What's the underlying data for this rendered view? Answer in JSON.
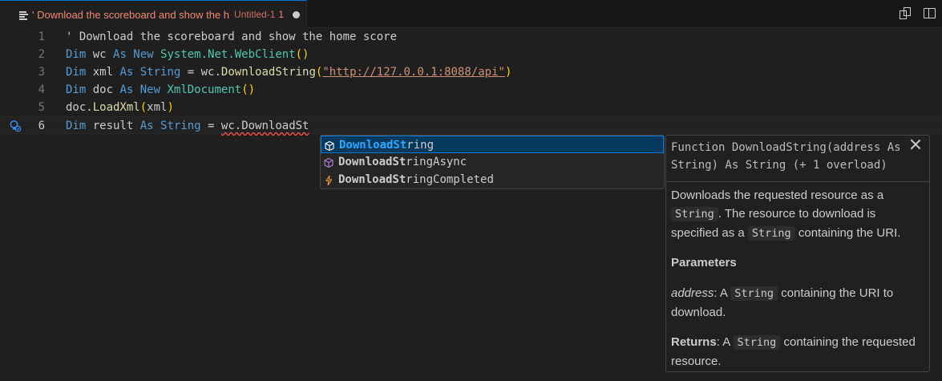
{
  "tab": {
    "title": "' Download the scoreboard and show the h",
    "description": "Untitled-1",
    "problem_count": "1"
  },
  "icons": {
    "tab_icon": "lines-icon",
    "split_editor": "split-editor-icon",
    "compare": "compare-icon",
    "lightbulb": "lightbulb-autofix-icon"
  },
  "editor": {
    "lines": [
      {
        "number": "1",
        "text": "' Download the scoreboard and show the home score"
      },
      {
        "number": "2",
        "text": "Dim wc As New System.Net.WebClient()"
      },
      {
        "number": "3",
        "text": "Dim xml As String = wc.DownloadString(\"http://127.0.0.1:8088/api\")"
      },
      {
        "number": "4",
        "text": "Dim doc As New XmlDocument()"
      },
      {
        "number": "5",
        "text": "doc.LoadXml(xml)"
      },
      {
        "number": "6",
        "text": "Dim result As String = wc.DownloadSt"
      }
    ],
    "tokens": {
      "l2_dim": "Dim",
      "l2_var": " wc ",
      "l2_as": "As",
      "l2_new": " New ",
      "l2_type": "System.Net.WebClient",
      "l2_paren": "()",
      "l3_dim": "Dim",
      "l3_var": " xml ",
      "l3_as": "As",
      "l3_type": " String",
      "l3_eq": " = wc.",
      "l3_fn": "DownloadString",
      "l3_open": "(",
      "l3_str": "\"http://127.0.0.1:8088/api\"",
      "l3_close": ")",
      "l4_dim": "Dim",
      "l4_var": " doc ",
      "l4_as": "As",
      "l4_new": " New ",
      "l4_type": "XmlDocument",
      "l4_paren": "()",
      "l5_obj": "doc.",
      "l5_fn": "LoadXml",
      "l5_open": "(",
      "l5_arg": "xml",
      "l5_close": ")",
      "l6_dim": "Dim",
      "l6_var": " result ",
      "l6_as": "As",
      "l6_type": " String",
      "l6_eq": " = ",
      "l6_typed": "wc.DownloadSt"
    }
  },
  "suggestions": [
    {
      "match": "DownloadSt",
      "rest": "ring",
      "kind": "method-icon",
      "focused": true
    },
    {
      "match": "DownloadSt",
      "rest": "ringAsync",
      "kind": "method-icon",
      "focused": false
    },
    {
      "match": "DownloadSt",
      "rest": "ringCompleted",
      "kind": "event-icon",
      "focused": false
    }
  ],
  "details": {
    "signature": "Function DownloadString(address As String) As String (+ 1 overload)",
    "desc_a": "Downloads the requested resource as a",
    "desc_code1": "String",
    "desc_b": ". The resource to download is specified as a",
    "desc_code2": "String",
    "desc_c": "containing the URI.",
    "params_heading": "Parameters",
    "param_name": "address",
    "param_a": ": A",
    "param_code": "String",
    "param_b": "containing the URI to download.",
    "returns_label": "Returns",
    "returns_a": ": A",
    "returns_code": "String",
    "returns_b": "containing the requested resource."
  },
  "colors": {
    "background": "#1f1f1f",
    "keyword": "#569cd6",
    "type": "#4ec9b0",
    "function": "#dcdcaa",
    "string": "#ce9178",
    "error_tab": "#f48771",
    "accent": "#0078d4"
  }
}
